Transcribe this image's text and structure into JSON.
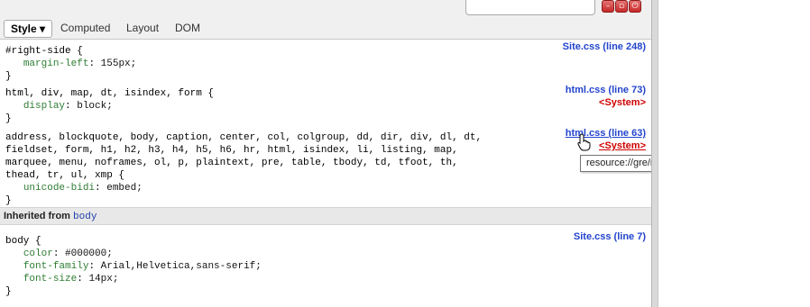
{
  "tabs": {
    "style_label": "Style",
    "style_arrow": "▾",
    "computed_label": "Computed",
    "layout_label": "Layout",
    "dom_label": "DOM"
  },
  "window_buttons": [
    "minimize-icon",
    "restore-icon",
    "close-icon"
  ],
  "rules": [
    {
      "selector": "#right-side {",
      "declarations": [
        {
          "name": "margin-left",
          "value": "155px;"
        }
      ],
      "closing": "}",
      "source": "Site.css (line 248)"
    },
    {
      "selector": "html, div, map, dt, isindex, form {",
      "declarations": [
        {
          "name": "display",
          "value": "block;"
        }
      ],
      "closing": "}",
      "source": "html.css (line 73)",
      "system": "<System>"
    },
    {
      "selector_lines": [
        "address, blockquote, body, caption, center, col, colgroup, dd, dir, div, dl, dt,",
        "fieldset, form, h1, h2, h3, h4, h5, h6, hr, html, isindex, li, listing, map,",
        "marquee, menu, noframes, ol, p, plaintext, pre, table, tbody, td, tfoot, th,",
        "thead, tr, ul, xmp {"
      ],
      "declarations": [
        {
          "name": "unicode-bidi",
          "value": "embed;"
        }
      ],
      "closing": "}",
      "source": "html.css (line 63)",
      "system": "<System>"
    }
  ],
  "inherited": {
    "label": "Inherited from ",
    "element": "body"
  },
  "body_rule": {
    "selector": "body {",
    "declarations": [
      {
        "name": "color",
        "value": "#000000;"
      },
      {
        "name": "font-family",
        "value": "Arial,Helvetica,sans-serif;"
      },
      {
        "name": "font-size",
        "value": "14px;"
      }
    ],
    "closing": "}",
    "source": "Site.css (line 7)"
  },
  "tooltip": "resource://gre/res/html.css",
  "colors": {
    "link": "#2244cc",
    "system": "#d00000",
    "property": "#2e7d32"
  }
}
